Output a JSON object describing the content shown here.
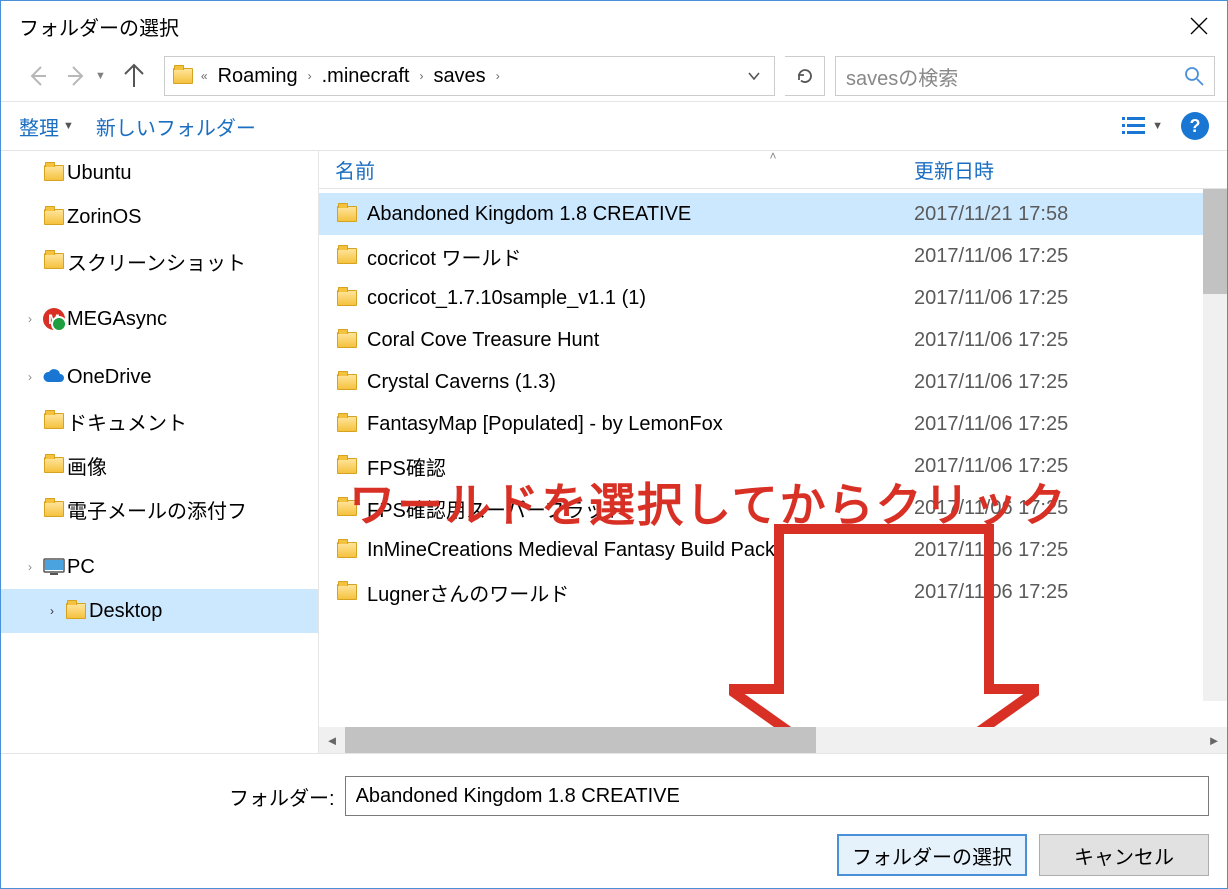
{
  "window": {
    "title": "フォルダーの選択"
  },
  "breadcrumbs": {
    "levels": [
      "Roaming",
      ".minecraft",
      "saves"
    ],
    "overflow": "«"
  },
  "search": {
    "placeholder": "savesの検索"
  },
  "toolbar": {
    "organize": "整理",
    "new_folder": "新しいフォルダー"
  },
  "sidebar": {
    "items": [
      {
        "label": "Ubuntu",
        "type": "folder",
        "sub": true
      },
      {
        "label": "ZorinOS",
        "type": "folder",
        "sub": true
      },
      {
        "label": "スクリーンショット",
        "type": "folder",
        "sub": true
      },
      {
        "label": "MEGAsync",
        "type": "mega",
        "sub": false,
        "expand": ">"
      },
      {
        "label": "OneDrive",
        "type": "onedrive",
        "sub": false,
        "expand": ">"
      },
      {
        "label": "ドキュメント",
        "type": "folder",
        "sub": true
      },
      {
        "label": "画像",
        "type": "folder",
        "sub": true
      },
      {
        "label": "電子メールの添付フ",
        "type": "folder",
        "sub": true
      },
      {
        "label": "PC",
        "type": "pc",
        "sub": false,
        "expand": ">"
      },
      {
        "label": "Desktop",
        "type": "folder",
        "sub": true,
        "expand": ">",
        "selected": true
      }
    ]
  },
  "columns": {
    "name": "名前",
    "modified": "更新日時"
  },
  "files": [
    {
      "name": "Abandoned Kingdom 1.8 CREATIVE",
      "date": "2017/11/21 17:58",
      "selected": true
    },
    {
      "name": "cocricot ワールド",
      "date": "2017/11/06 17:25"
    },
    {
      "name": "cocricot_1.7.10sample_v1.1 (1)",
      "date": "2017/11/06 17:25"
    },
    {
      "name": "Coral Cove Treasure Hunt",
      "date": "2017/11/06 17:25"
    },
    {
      "name": "Crystal Caverns (1.3)",
      "date": "2017/11/06 17:25"
    },
    {
      "name": "FantasyMap [Populated] - by LemonFox",
      "date": "2017/11/06 17:25"
    },
    {
      "name": "FPS確認",
      "date": "2017/11/06 17:25"
    },
    {
      "name": "FPS確認用スーパーフラット",
      "date": "2017/11/06 17:25"
    },
    {
      "name": "InMineCreations Medieval Fantasy Build Pack",
      "date": "2017/11/06 17:25"
    },
    {
      "name": "Lugnerさんのワールド",
      "date": "2017/11/06 17:25"
    }
  ],
  "footer": {
    "folder_label": "フォルダー:",
    "folder_value": "Abandoned Kingdom 1.8 CREATIVE",
    "select_button": "フォルダーの選択",
    "cancel_button": "キャンセル"
  },
  "annotation": {
    "text": "ワールドを選択してからクリック"
  }
}
